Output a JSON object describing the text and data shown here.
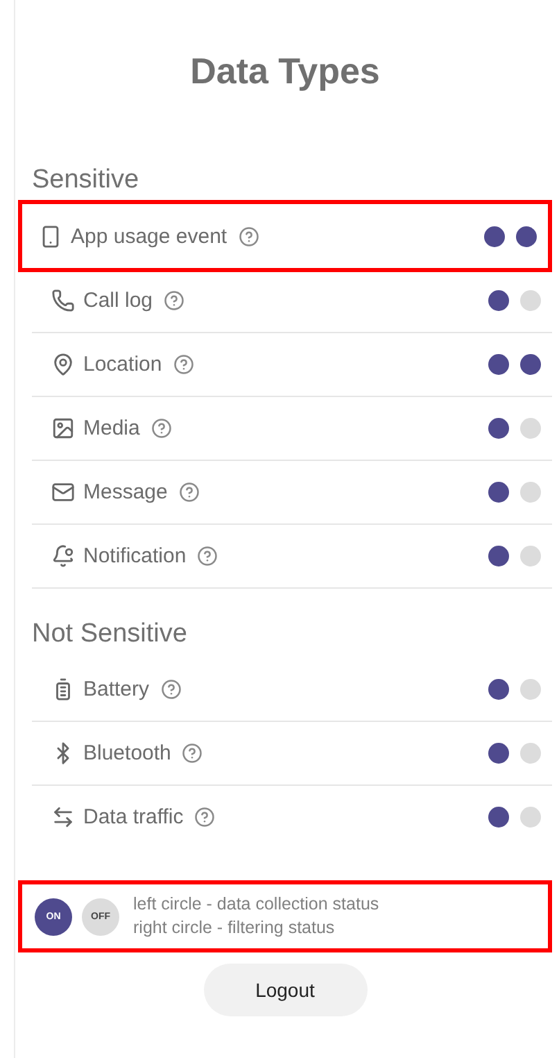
{
  "title": "Data Types",
  "sections": [
    {
      "heading": "Sensitive",
      "items": [
        {
          "label": "App usage event",
          "collecting": true,
          "filtering": true,
          "highlighted": true
        },
        {
          "label": "Call log",
          "collecting": true,
          "filtering": false,
          "highlighted": false
        },
        {
          "label": "Location",
          "collecting": true,
          "filtering": true,
          "highlighted": false
        },
        {
          "label": "Media",
          "collecting": true,
          "filtering": false,
          "highlighted": false
        },
        {
          "label": "Message",
          "collecting": true,
          "filtering": false,
          "highlighted": false
        },
        {
          "label": "Notification",
          "collecting": true,
          "filtering": false,
          "highlighted": false
        }
      ]
    },
    {
      "heading": "Not Sensitive",
      "items": [
        {
          "label": "Battery",
          "collecting": true,
          "filtering": false,
          "highlighted": false
        },
        {
          "label": "Bluetooth",
          "collecting": true,
          "filtering": false,
          "highlighted": false
        },
        {
          "label": "Data traffic",
          "collecting": true,
          "filtering": false,
          "highlighted": false
        }
      ]
    }
  ],
  "legend": {
    "highlighted": true,
    "on_label": "ON",
    "off_label": "OFF",
    "lines": [
      "left circle - data collection status",
      "right circle - filtering status"
    ]
  },
  "logout": "Logout"
}
